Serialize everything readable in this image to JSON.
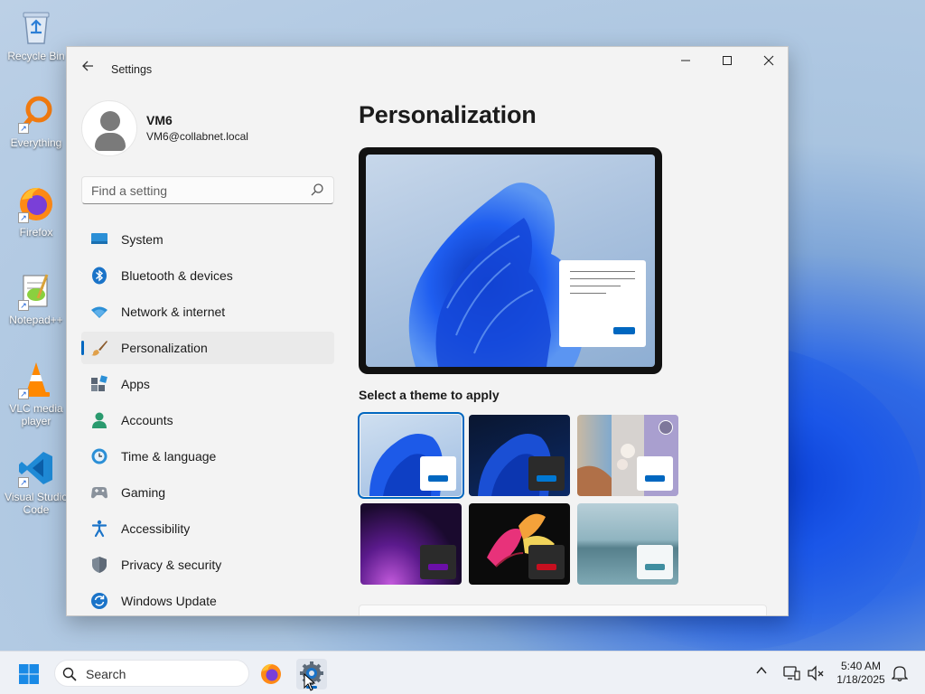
{
  "desktop": {
    "icons": [
      {
        "label": "Recycle Bin",
        "icon": "recycle-bin-icon"
      },
      {
        "label": "Everything",
        "icon": "magnifier-orange-icon"
      },
      {
        "label": "Firefox",
        "icon": "firefox-icon"
      },
      {
        "label": "Notepad++",
        "icon": "notepad-plus-plus-icon"
      },
      {
        "label": "VLC media player",
        "icon": "vlc-cone-icon"
      },
      {
        "label": "Visual Studio Code",
        "icon": "vscode-icon"
      }
    ]
  },
  "window": {
    "title": "Settings",
    "user": {
      "name": "VM6",
      "email": "VM6@collabnet.local"
    },
    "search": {
      "placeholder": "Find a setting"
    },
    "nav": [
      {
        "label": "System",
        "icon": "monitor-icon"
      },
      {
        "label": "Bluetooth & devices",
        "icon": "bluetooth-icon"
      },
      {
        "label": "Network & internet",
        "icon": "wifi-icon"
      },
      {
        "label": "Personalization",
        "icon": "paintbrush-icon",
        "active": true
      },
      {
        "label": "Apps",
        "icon": "apps-icon"
      },
      {
        "label": "Accounts",
        "icon": "person-icon"
      },
      {
        "label": "Time & language",
        "icon": "clock-globe-icon"
      },
      {
        "label": "Gaming",
        "icon": "gamepad-icon"
      },
      {
        "label": "Accessibility",
        "icon": "accessibility-icon"
      },
      {
        "label": "Privacy & security",
        "icon": "shield-icon"
      },
      {
        "label": "Windows Update",
        "icon": "update-icon"
      }
    ],
    "page_title": "Personalization",
    "theme_section_label": "Select a theme to apply",
    "themes": [
      {
        "name": "windows-light",
        "selected": true,
        "accent": "#0067c0"
      },
      {
        "name": "windows-dark",
        "selected": false,
        "accent": "#0078d4"
      },
      {
        "name": "spotlight",
        "selected": false,
        "accent": "#0067c0"
      },
      {
        "name": "glow",
        "selected": false,
        "accent": "#6b0fa8"
      },
      {
        "name": "captured-motion",
        "selected": false,
        "accent": "#c50f1f"
      },
      {
        "name": "flow",
        "selected": false,
        "accent": "#3f8ea0"
      }
    ]
  },
  "taskbar": {
    "search_text": "Search",
    "time": "5:40 AM",
    "date": "1/18/2025"
  },
  "colors": {
    "accent": "#0067c0",
    "window_bg": "#f3f3f3",
    "taskbar_bg": "#eef1f6"
  }
}
